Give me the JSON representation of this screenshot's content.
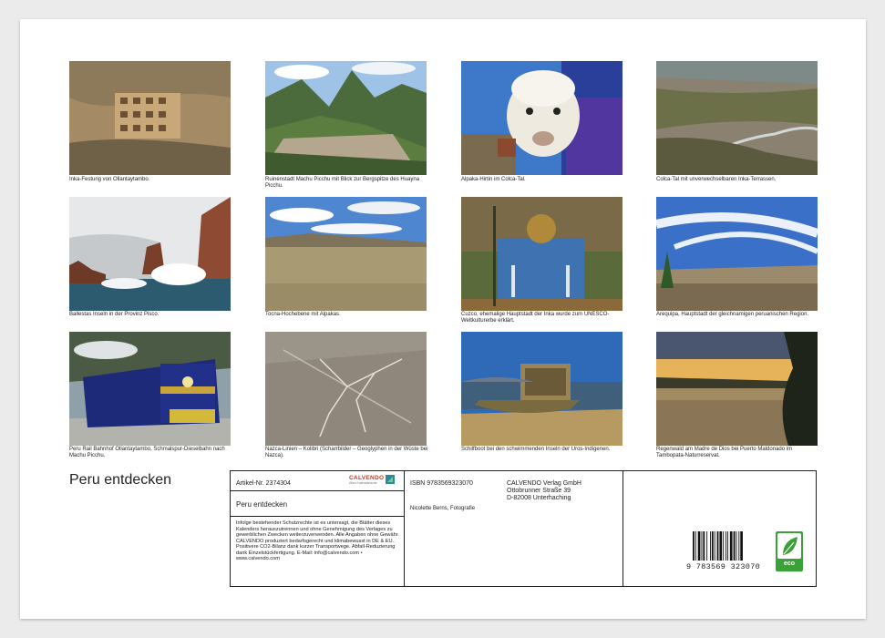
{
  "calendar": {
    "title": "Peru entdecken",
    "photos": [
      {
        "caption": "Inka-Festung von Ollantaytambo."
      },
      {
        "caption": "Ruinenstadt Machu Picchu mit Blick zur Bergspitze des Huayna Picchu."
      },
      {
        "caption": "Alpaka-Hirtin im Colca-Tal."
      },
      {
        "caption": "Colca-Tal mit unverwechselbaren Inka-Terrassen."
      },
      {
        "caption": "Ballestas Inseln in der Provinz Pisco."
      },
      {
        "caption": "Tocna-Hochebene mit Alpakas."
      },
      {
        "caption": "Cuzco, ehemalige Hauptstadt der Inka wurde zum UNESCO-Weltkulturerbe erklärt."
      },
      {
        "caption": "Arequipa, Hauptstadt der gleichnamigen peruanischen Region."
      },
      {
        "caption": "Peru Rail Bahnhof Ollantaytambo, Schmalspur-Dieselbahn nach Machu Picchu."
      },
      {
        "caption": "Nazca-Linien – Kolibri (Scharrbilder – Geoglyphen in der Wüste bei Nazca)."
      },
      {
        "caption": "Schilfboot bei den schwimmenden Inseln der Uros-Indigenen."
      },
      {
        "caption": "Regenwald am Madre de Dios bei Puerto Maldonado im Tambopata-Naturreservat."
      }
    ]
  },
  "info": {
    "article": "Artikel-Nr. 2374304",
    "logo": "CALVENDO",
    "logo_sub": "Alles Kalendarische",
    "title": "Peru entdecken",
    "legal": "Infolge bestehender Schutzrechte ist es untersagt, die Blätter dieses Kalenders herauszutrennen und ohne Genehmigung des Verlages zu gewerblichen Zwecken weiterzuverwenden. Alle Angaben ohne Gewähr. CALVENDO produziert bedarfsgerecht und klimabewusst in DE & EU. Positivere CO2-Bilanz dank kurzer Transportwege. Abfall-Reduzierung dank Einzelstückfertigung. E-Mail: info@calvendo.com • www.calvendo.com",
    "isbn": "ISBN 9783569323070",
    "author": "Nicolette Berns, Fotografie",
    "publisher": "CALVENDO Verlag GmbH",
    "street": "Ottobrunner Straße 39",
    "city": "D-82008 Unterhaching",
    "barcode_number": "9 783569 323070",
    "eco_label": "eco"
  }
}
